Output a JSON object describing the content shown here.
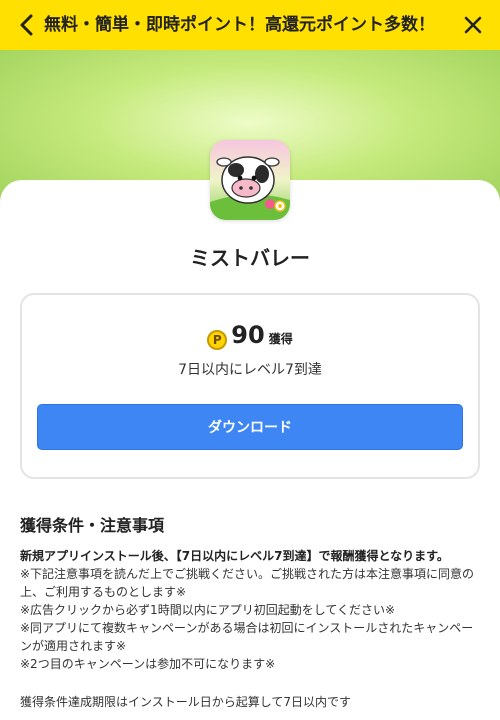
{
  "header": {
    "title": "無料・簡単・即時ポイント！高還元ポイント多数！",
    "back_icon": "chevron-left-icon",
    "close_icon": "close-icon",
    "background_color": "#ffe000"
  },
  "app": {
    "name": "ミストバレー",
    "icon": "cow-app-icon"
  },
  "offer": {
    "points": "90",
    "points_unit": "獲得",
    "point_icon_label": "P",
    "condition": "7日以内にレベル7到達",
    "download_label": "ダウンロード",
    "accent_color": "#3d86f4"
  },
  "notes": {
    "title": "獲得条件・注意事項",
    "lead": "新規アプリインストール後、【7日以内にレベル7到達】で報酬獲得となります。",
    "items": [
      "※下記注意事項を読んだ上でご挑戦ください。ご挑戦された方は本注意事項に同意の上、ご利用するものとします※",
      "※広告クリックから必ず1時間以内にアプリ初回起動をしてください※",
      "※同アプリにて複数キャンペーンがある場合は初回にインストールされたキャンペーンが適用されます※",
      "※2つ目のキャンペーンは参加不可になります※"
    ],
    "trailing": "獲得条件達成期限はインストール日から起算して7日以内です"
  }
}
